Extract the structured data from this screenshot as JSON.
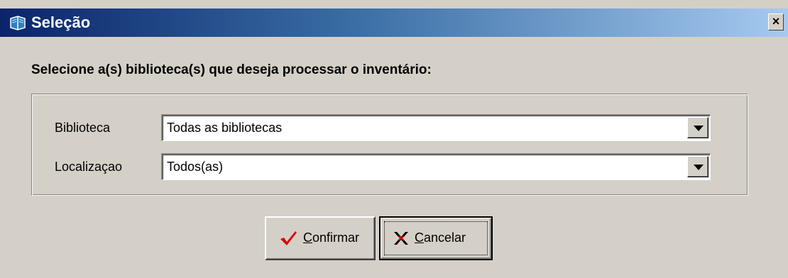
{
  "window": {
    "title": "Seleção",
    "close_glyph": "×"
  },
  "prompt": "Selecione a(s) biblioteca(s) que deseja processar o inventário:",
  "fields": [
    {
      "label": "Biblioteca",
      "value": "Todas as bibliotecas"
    },
    {
      "label": "Localizaçao",
      "value": "Todos(as)"
    }
  ],
  "buttons": {
    "confirm": {
      "mnemonic": "C",
      "rest": "onfirmar",
      "icon": "checkmark-icon"
    },
    "cancel": {
      "mnemonic": "C",
      "rest": "ancelar",
      "icon": "x-mark-icon"
    }
  },
  "colors": {
    "titlebar_start": "#0a246a",
    "titlebar_end": "#a6caf0",
    "face": "#d4d0c8",
    "confirm_icon": "#e00000",
    "cancel_icon": "#000000"
  }
}
